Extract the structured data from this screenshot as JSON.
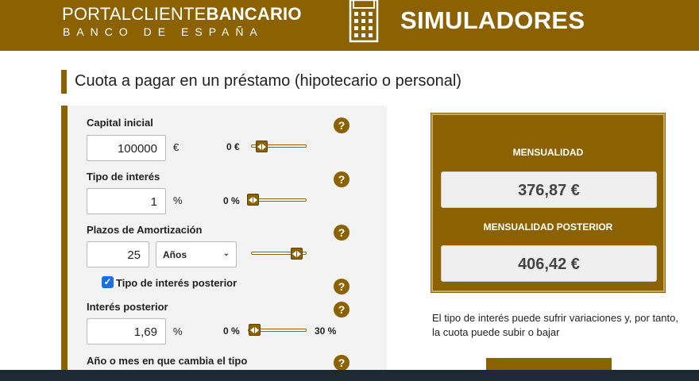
{
  "header": {
    "brand_regular": "PORTALCLIENTE",
    "brand_bold": "BANCARIO",
    "brand_sub": "BANCO DE ESPAÑA",
    "section": "SIMULADORES"
  },
  "page": {
    "title": "Cuota a pagar en un préstamo (hipotecario o personal)"
  },
  "form": {
    "capital": {
      "label": "Capital inicial",
      "value": "100000",
      "unit": "€",
      "min": "0 €"
    },
    "interest": {
      "label": "Tipo de interés",
      "value": "1",
      "unit": "%",
      "min": "0 %"
    },
    "term": {
      "label": "Plazos de Amortización",
      "value": "25",
      "unit_selected": "Años"
    },
    "posterior_check": {
      "label": "Tipo de interés posterior",
      "checked": true
    },
    "posterior": {
      "label": "Interés posterior",
      "value": "1,69",
      "unit": "%",
      "min": "0 %",
      "max": "30 %"
    },
    "change": {
      "label": "Año o mes en que cambia el tipo"
    },
    "help_glyph": "?",
    "check_glyph": "✓",
    "select_chevron": "⌄"
  },
  "result": {
    "monthly_label": "MENSUALIDAD",
    "monthly_value": "376,87 €",
    "posterior_label": "MENSUALIDAD POSTERIOR",
    "posterior_value": "406,42 €",
    "note": "El tipo de interés puede sufrir variaciones y, por tanto, la cuota puede subir o bajar"
  },
  "colors": {
    "brand": "#8c6100",
    "bottom_bar": "#1e2a33"
  },
  "icons": [
    "calculator-icon",
    "help-icon",
    "chevron-down-icon",
    "checkmark-icon"
  ]
}
